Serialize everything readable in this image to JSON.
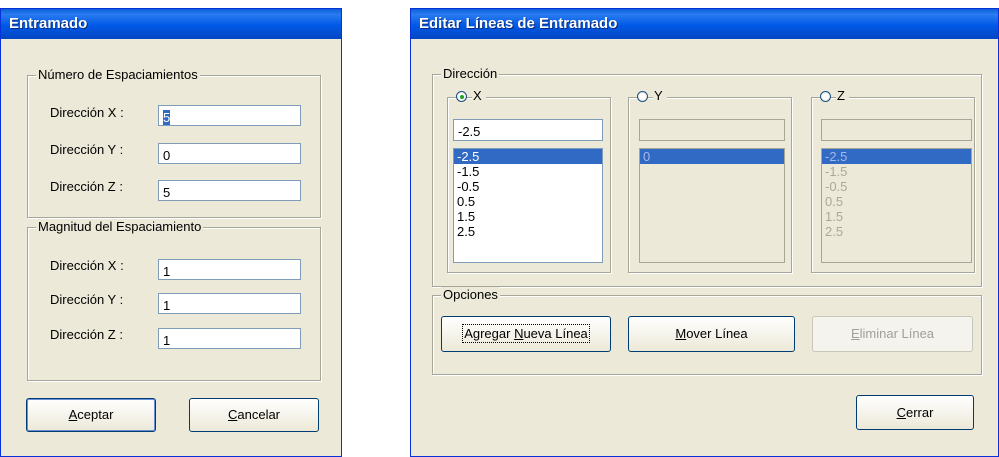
{
  "entramado": {
    "title": "Entramado",
    "num_group": {
      "label": "Número de Espaciamientos",
      "rows": [
        {
          "label": "Dirección X :",
          "value": "5"
        },
        {
          "label": "Dirección Y :",
          "value": "0"
        },
        {
          "label": "Dirección Z :",
          "value": "5"
        }
      ]
    },
    "mag_group": {
      "label": "Magnitud del Espaciamiento",
      "rows": [
        {
          "label": "Dirección X :",
          "value": "1"
        },
        {
          "label": "Dirección Y :",
          "value": "1"
        },
        {
          "label": "Dirección Z :",
          "value": "1"
        }
      ]
    },
    "accept_button": {
      "mnemonic": "A",
      "rest": "ceptar"
    },
    "cancel_button": {
      "mnemonic": "C",
      "rest": "ancelar"
    }
  },
  "editar": {
    "title": "Editar Líneas de Entramado",
    "direccion_label": "Dirección",
    "axes": [
      {
        "label": "X",
        "checked": true,
        "input": "-2.5",
        "items": [
          "-2.5",
          "-1.5",
          "-0.5",
          "0.5",
          "1.5",
          "2.5"
        ],
        "enabled": true
      },
      {
        "label": "Y",
        "checked": false,
        "input": "",
        "items": [
          "0"
        ],
        "enabled": false
      },
      {
        "label": "Z",
        "checked": false,
        "input": "",
        "items": [
          "-2.5",
          "-1.5",
          "-0.5",
          "0.5",
          "1.5",
          "2.5"
        ],
        "enabled": false
      }
    ],
    "opciones_label": "Opciones",
    "add_button": {
      "pre": "Agregar ",
      "mnemonic": "N",
      "post": "ueva Línea"
    },
    "move_button": {
      "mnemonic": "M",
      "post": "over Línea"
    },
    "delete_button": {
      "mnemonic": "E",
      "post": "liminar Línea"
    },
    "close_button": {
      "mnemonic": "C",
      "post": "errar"
    }
  },
  "colors": {
    "titlebar": "#0058e6",
    "face": "#ece9d8",
    "selection": "#316ac5"
  }
}
